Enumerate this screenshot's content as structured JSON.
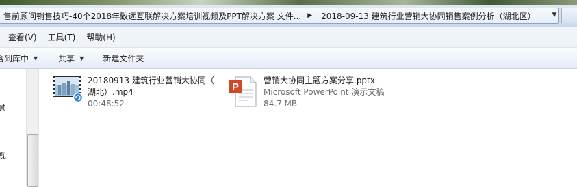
{
  "address": {
    "crumbs": [
      "售前顾问销售技巧-40个2018年致远互联解决方案培训视频及PPT解决方案 文件...",
      "2018-09-13 建筑行业营销大协同销售案例分析（湖北区）"
    ]
  },
  "menu": {
    "items": [
      "查看(V)",
      "工具(T)",
      "帮助(H)"
    ]
  },
  "toolbar": {
    "library_label": "含到库中",
    "share_label": "共享",
    "new_folder_label": "新建文件夹"
  },
  "nav": {
    "text_1": "顾",
    "text_2": "视"
  },
  "files": [
    {
      "name_line1": "20180913 建筑行业营销大协同（",
      "name_line2": "湖北）.mp4",
      "sub": "00:48:52"
    },
    {
      "name_line1": "营销大协同主题方案分享.pptx",
      "type": "Microsoft PowerPoint 演示文稿",
      "size": "84.7 MB"
    }
  ]
}
